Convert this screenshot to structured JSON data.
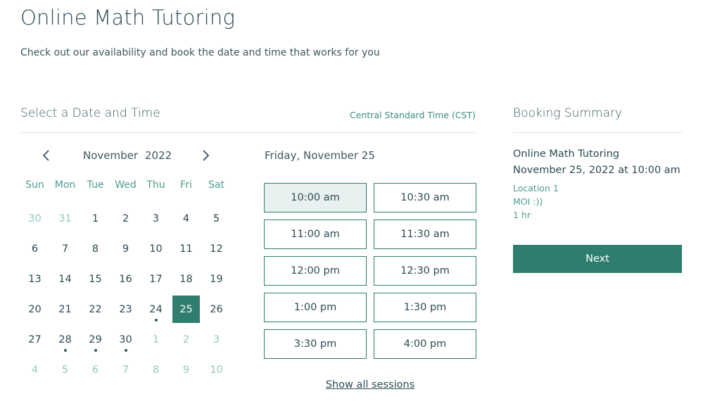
{
  "page": {
    "title": "Online Math Tutoring",
    "subtitle": "Check out our availability and book the date and time that works for you"
  },
  "calendar": {
    "section_title": "Select a Date and Time",
    "timezone": "Central Standard Time (CST)",
    "month": "November",
    "year": "2022",
    "prev_icon": "chevron-left-icon",
    "next_icon": "chevron-right-icon",
    "weekdays": [
      "Sun",
      "Mon",
      "Tue",
      "Wed",
      "Thu",
      "Fri",
      "Sat"
    ],
    "days": [
      {
        "label": "30",
        "outside": true,
        "available": false,
        "selected": false
      },
      {
        "label": "31",
        "outside": true,
        "available": false,
        "selected": false
      },
      {
        "label": "1",
        "outside": false,
        "available": false,
        "selected": false
      },
      {
        "label": "2",
        "outside": false,
        "available": false,
        "selected": false
      },
      {
        "label": "3",
        "outside": false,
        "available": false,
        "selected": false
      },
      {
        "label": "4",
        "outside": false,
        "available": false,
        "selected": false
      },
      {
        "label": "5",
        "outside": false,
        "available": false,
        "selected": false
      },
      {
        "label": "6",
        "outside": false,
        "available": false,
        "selected": false
      },
      {
        "label": "7",
        "outside": false,
        "available": false,
        "selected": false
      },
      {
        "label": "8",
        "outside": false,
        "available": false,
        "selected": false
      },
      {
        "label": "9",
        "outside": false,
        "available": false,
        "selected": false
      },
      {
        "label": "10",
        "outside": false,
        "available": false,
        "selected": false
      },
      {
        "label": "11",
        "outside": false,
        "available": false,
        "selected": false
      },
      {
        "label": "12",
        "outside": false,
        "available": false,
        "selected": false
      },
      {
        "label": "13",
        "outside": false,
        "available": false,
        "selected": false
      },
      {
        "label": "14",
        "outside": false,
        "available": false,
        "selected": false
      },
      {
        "label": "15",
        "outside": false,
        "available": false,
        "selected": false
      },
      {
        "label": "16",
        "outside": false,
        "available": false,
        "selected": false
      },
      {
        "label": "17",
        "outside": false,
        "available": false,
        "selected": false
      },
      {
        "label": "18",
        "outside": false,
        "available": false,
        "selected": false
      },
      {
        "label": "19",
        "outside": false,
        "available": false,
        "selected": false
      },
      {
        "label": "20",
        "outside": false,
        "available": false,
        "selected": false
      },
      {
        "label": "21",
        "outside": false,
        "available": false,
        "selected": false
      },
      {
        "label": "22",
        "outside": false,
        "available": false,
        "selected": false
      },
      {
        "label": "23",
        "outside": false,
        "available": false,
        "selected": false
      },
      {
        "label": "24",
        "outside": false,
        "available": true,
        "selected": false
      },
      {
        "label": "25",
        "outside": false,
        "available": false,
        "selected": true
      },
      {
        "label": "26",
        "outside": false,
        "available": false,
        "selected": false
      },
      {
        "label": "27",
        "outside": false,
        "available": false,
        "selected": false
      },
      {
        "label": "28",
        "outside": false,
        "available": true,
        "selected": false
      },
      {
        "label": "29",
        "outside": false,
        "available": true,
        "selected": false
      },
      {
        "label": "30",
        "outside": false,
        "available": true,
        "selected": false
      },
      {
        "label": "1",
        "outside": true,
        "available": false,
        "selected": false
      },
      {
        "label": "2",
        "outside": true,
        "available": false,
        "selected": false
      },
      {
        "label": "3",
        "outside": true,
        "available": false,
        "selected": false
      },
      {
        "label": "4",
        "outside": true,
        "available": false,
        "selected": false
      },
      {
        "label": "5",
        "outside": true,
        "available": false,
        "selected": false
      },
      {
        "label": "6",
        "outside": true,
        "available": false,
        "selected": false
      },
      {
        "label": "7",
        "outside": true,
        "available": false,
        "selected": false
      },
      {
        "label": "8",
        "outside": true,
        "available": false,
        "selected": false
      },
      {
        "label": "9",
        "outside": true,
        "available": false,
        "selected": false
      },
      {
        "label": "10",
        "outside": true,
        "available": false,
        "selected": false
      }
    ]
  },
  "times": {
    "selected_date_label": "Friday, November 25",
    "slots": [
      {
        "label": "10:00 am",
        "active": true
      },
      {
        "label": "10:30 am",
        "active": false
      },
      {
        "label": "11:00 am",
        "active": false
      },
      {
        "label": "11:30 am",
        "active": false
      },
      {
        "label": "12:00 pm",
        "active": false
      },
      {
        "label": "12:30 pm",
        "active": false
      },
      {
        "label": "1:00 pm",
        "active": false
      },
      {
        "label": "1:30 pm",
        "active": false
      },
      {
        "label": "3:30 pm",
        "active": false
      },
      {
        "label": "4:00 pm",
        "active": false
      }
    ],
    "show_all_label": "Show all sessions"
  },
  "summary": {
    "title": "Booking Summary",
    "service": "Online Math Tutoring",
    "datetime": "November 25, 2022 at 10:00 am",
    "location": "Location 1",
    "staff": "MOI :))",
    "duration": "1 hr",
    "next_label": "Next"
  },
  "colors": {
    "accent": "#2e7d6e",
    "text": "#2d4a52",
    "muted": "#4d9c90",
    "outside_day": "#93c6bf",
    "active_slot_bg": "#e8f1ef"
  }
}
